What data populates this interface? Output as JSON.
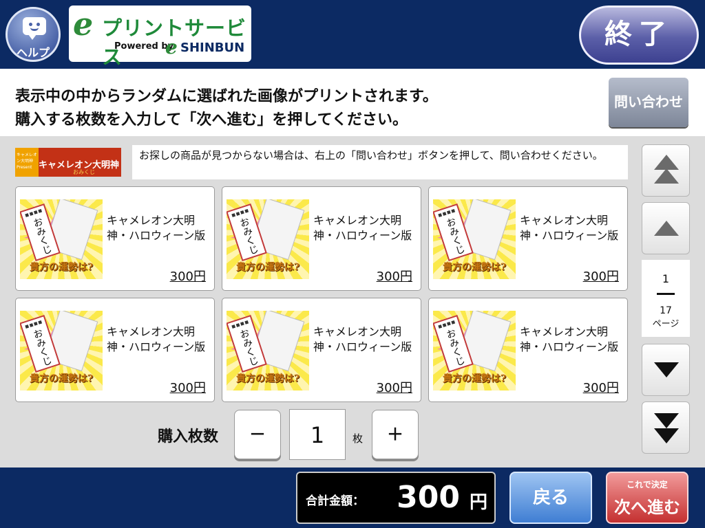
{
  "header": {
    "help_label": "ヘルプ",
    "logo_title": "プリントサービス",
    "logo_e": "e",
    "logo_powered": "Powered by",
    "logo_e2": "e",
    "logo_shinbun": "SHINBUN",
    "end_label": "終了"
  },
  "instructions": {
    "line1": "表示中の中からランダムに選ばれた画像がプリントされます。",
    "line2": "購入する枚数を入力して「次へ進む」を押してください。",
    "inquiry_label": "問い合わせ"
  },
  "campaign": {
    "ribbon": "キャメレオン大明神 Present",
    "title": "キャメレオン大明神",
    "sub": "おみくじ",
    "notice": "お探しの商品が見つからない場合は、右上の「問い合わせ」ボタンを押して、問い合わせください。"
  },
  "products": [
    {
      "name": "キャメレオン大明神・ハロウィーン版",
      "price": "300円",
      "slip_text": "おみくじ",
      "fortune_text": "貴方の運勢は?"
    },
    {
      "name": "キャメレオン大明神・ハロウィーン版",
      "price": "300円",
      "slip_text": "おみくじ",
      "fortune_text": "貴方の運勢は?"
    },
    {
      "name": "キャメレオン大明神・ハロウィーン版",
      "price": "300円",
      "slip_text": "おみくじ",
      "fortune_text": "貴方の運勢は?"
    },
    {
      "name": "キャメレオン大明神・ハロウィーン版",
      "price": "300円",
      "slip_text": "おみくじ",
      "fortune_text": "貴方の運勢は?"
    },
    {
      "name": "キャメレオン大明神・ハロウィーン版",
      "price": "300円",
      "slip_text": "おみくじ",
      "fortune_text": "貴方の運勢は?"
    },
    {
      "name": "キャメレオン大明神・ハロウィーン版",
      "price": "300円",
      "slip_text": "おみくじ",
      "fortune_text": "貴方の運勢は?"
    }
  ],
  "quantity": {
    "label": "購入枚数",
    "minus": "－",
    "value": "1",
    "unit": "枚",
    "plus": "＋"
  },
  "pager": {
    "current": "1",
    "total": "17",
    "unit": "ページ"
  },
  "footer": {
    "total_label": "合計金額：",
    "total_value": "300",
    "total_unit": "円",
    "back_label": "戻る",
    "next_sub": "これで決定",
    "next_label": "次へ進む"
  },
  "colors": {
    "header_bg": "#0c2a63",
    "accent_green": "#1f8a3a",
    "back_blue": "#3f7ed3",
    "next_red": "#c43030"
  },
  "icons": [
    "help-chat-icon",
    "first-page-icon",
    "page-up-icon",
    "page-down-icon",
    "last-page-icon"
  ]
}
